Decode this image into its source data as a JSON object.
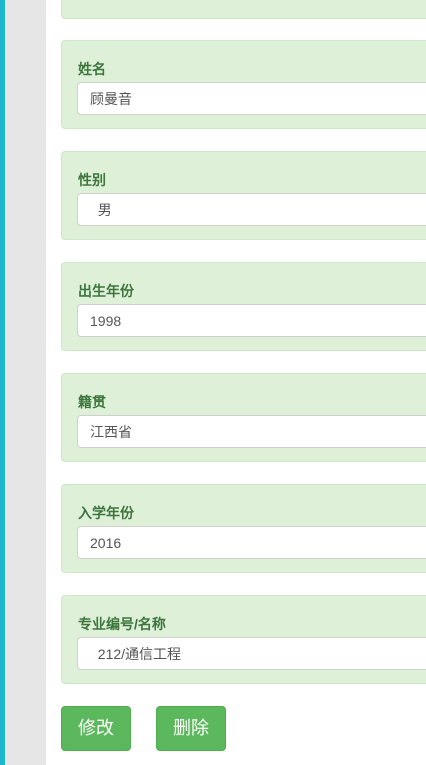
{
  "form": {
    "fields": [
      {
        "label": "姓名",
        "value": "顾曼音"
      },
      {
        "label": "性别",
        "value": "  男"
      },
      {
        "label": "出生年份",
        "value": "1998"
      },
      {
        "label": "籍贯",
        "value": "江西省"
      },
      {
        "label": "入学年份",
        "value": "2016"
      },
      {
        "label": "专业编号/名称",
        "value": "  212/通信工程"
      }
    ]
  },
  "actions": {
    "modify_label": "修改",
    "delete_label": "删除"
  },
  "colors": {
    "accent_strip": "#1fb6cf",
    "card_background": "#dff0d8",
    "label_text": "#3c763d",
    "button_background": "#5cb85c"
  }
}
